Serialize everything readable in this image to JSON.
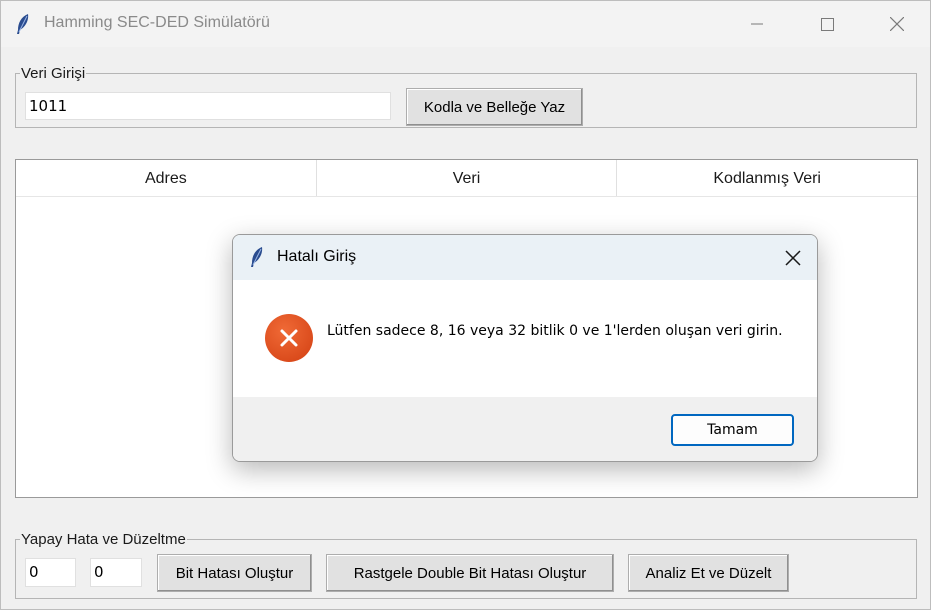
{
  "window": {
    "title": "Hamming SEC-DED Simülatörü",
    "icon": "feather-icon"
  },
  "veri_girisi": {
    "legend": "Veri Girişi",
    "input_value": "1011",
    "encode_button": "Kodla ve Belleğe Yaz"
  },
  "table": {
    "columns": [
      "Adres",
      "Veri",
      "Kodlanmış Veri"
    ],
    "rows": []
  },
  "yapay_hata": {
    "legend": "Yapay Hata ve Düzeltme",
    "input1_value": "0",
    "input2_value": "0",
    "bit_error_button": "Bit Hatası Oluştur",
    "double_bit_button": "Rastgele Double Bit Hatası Oluştur",
    "analyze_button": "Analiz Et ve Düzelt"
  },
  "dialog": {
    "title": "Hatalı Giriş",
    "message": "Lütfen sadece 8, 16 veya 32 bitlik 0 ve 1'lerden oluşan veri girin.",
    "ok_button": "Tamam",
    "icon": "error-icon"
  },
  "colors": {
    "error_icon": "#e2531d",
    "ok_border": "#0067c0",
    "dialog_title_bg": "#eaf1f6"
  }
}
